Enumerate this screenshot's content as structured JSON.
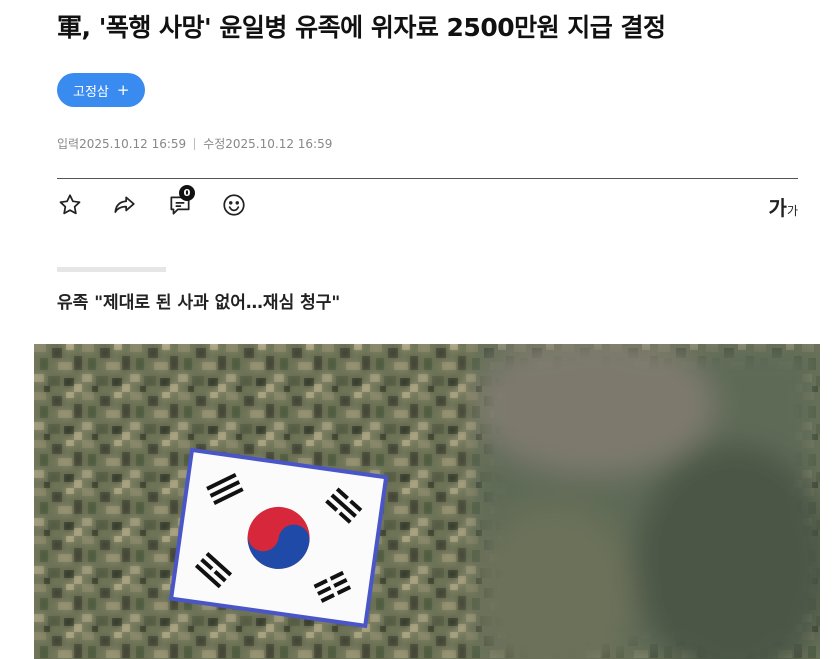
{
  "article": {
    "headline": "軍, '폭행 사망' 윤일병 유족에 위자료 2500만원 지급 결정",
    "author_chip": {
      "label": "고정삼",
      "plus": "+"
    },
    "dates": {
      "input": "입력2025.10.12 16:59",
      "modified": "수정2025.10.12 16:59"
    },
    "subtitle": "유족 \"제대로 된 사과 없어…재심 청구\""
  },
  "toolbar": {
    "icons": [
      "star-icon",
      "share-icon",
      "comment-icon",
      "emoji-icon"
    ],
    "comment_count": "0",
    "font_size_label_big": "가",
    "font_size_label_small": "가"
  },
  "colors": {
    "accent": "#3a8bf0",
    "camo_base": "#6f7559",
    "flag_red": "#d6283a",
    "flag_blue": "#1f4aa8"
  }
}
